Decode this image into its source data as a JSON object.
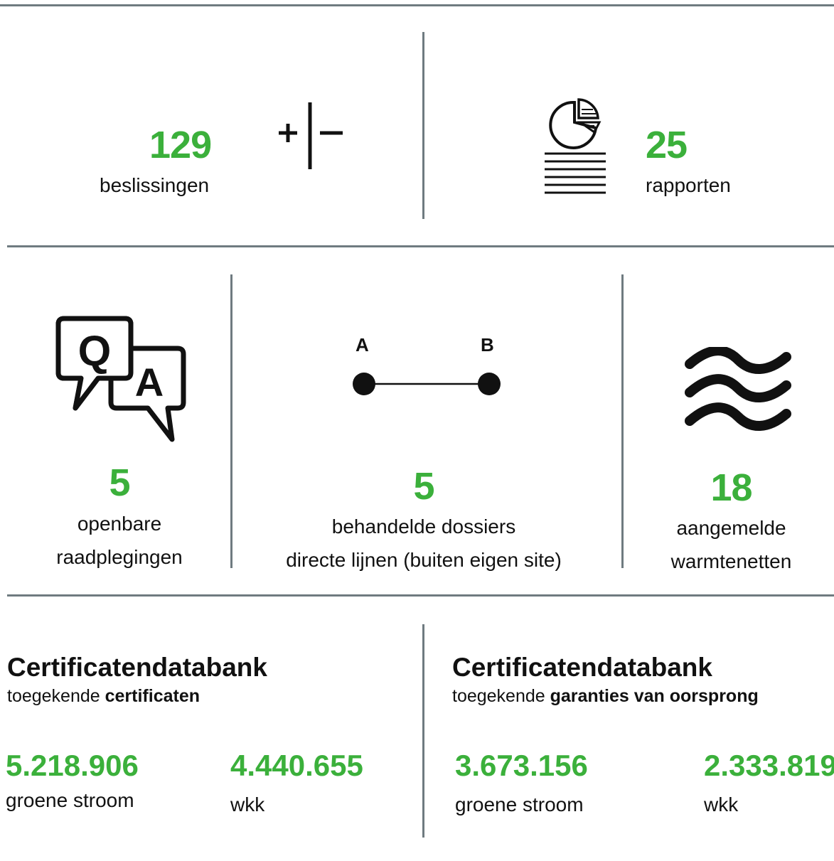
{
  "colors": {
    "accent_green": "#3bb03b",
    "divider": "#6f7b80",
    "text": "#111111"
  },
  "top": {
    "decisions": {
      "value": "129",
      "label": "beslissingen",
      "icon": "plus-minus-icon"
    },
    "reports": {
      "value": "25",
      "label": "rapporten",
      "icon": "report-pie-chart-icon"
    }
  },
  "middle": {
    "consultations": {
      "value": "5",
      "label_line1": "openbare",
      "label_line2": "raadplegingen",
      "icon": "qa-speech-bubbles-icon"
    },
    "direct_lines": {
      "value": "5",
      "label_line1": "behandelde dossiers",
      "label_line2": "directe lijnen (buiten eigen site)",
      "icon": "a-to-b-line-icon",
      "point_a": "A",
      "point_b": "B"
    },
    "heat_networks": {
      "value": "18",
      "label_line1": "aangemelde",
      "label_line2": "warmtenetten",
      "icon": "heat-waves-icon"
    }
  },
  "bottom": {
    "certificates": {
      "title": "Certificatendatabank",
      "subtitle_prefix": "toegekende ",
      "subtitle_bold": "certificaten",
      "items": [
        {
          "value": "5.218.906",
          "label": "groene stroom"
        },
        {
          "value": "4.440.655",
          "label": "wkk"
        }
      ]
    },
    "guarantees": {
      "title": "Certificatendatabank",
      "subtitle_prefix": "toegekende ",
      "subtitle_bold": "garanties van oorsprong",
      "items": [
        {
          "value": "3.673.156",
          "label": "groene stroom"
        },
        {
          "value": "2.333.819",
          "label": "wkk"
        }
      ]
    }
  }
}
